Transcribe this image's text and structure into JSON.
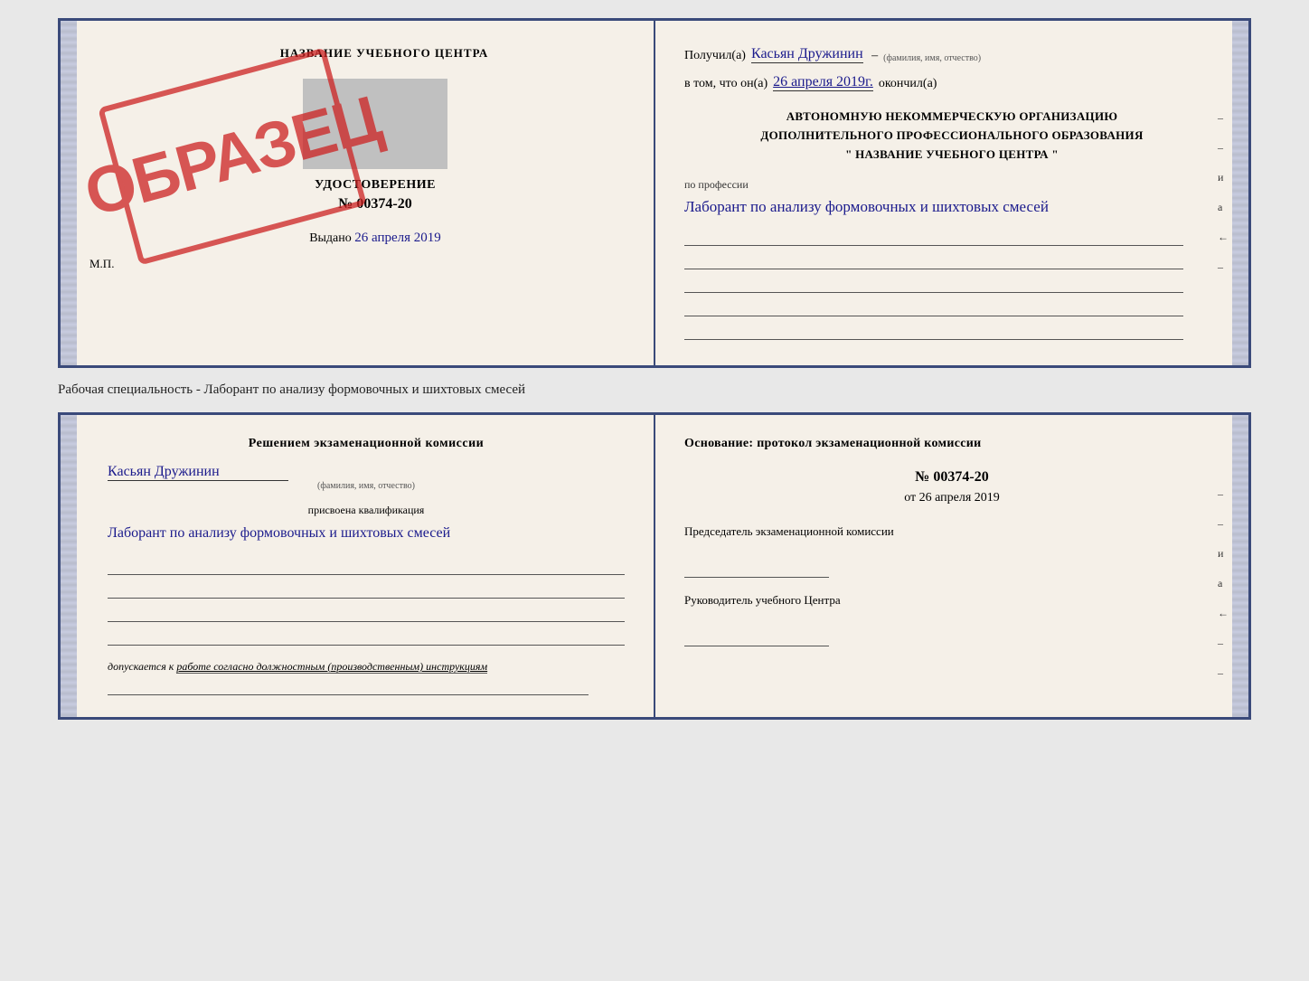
{
  "top_section": {
    "left": {
      "title": "НАЗВАНИЕ УЧЕБНОГО ЦЕНТРА",
      "cert_subtitle": "УДОСТОВЕРЕНИЕ",
      "cert_number": "№ 00374-20",
      "issued_label": "Выдано",
      "issued_date": "26 апреля 2019",
      "mp_label": "М.П."
    },
    "right": {
      "received_label": "Получил(а)",
      "recipient_name": "Касьян Дружинин",
      "fio_small": "(фамилия, имя, отчество)",
      "in_that_label": "в том, что он(а)",
      "date_completed": "26 апреля 2019г.",
      "finished_label": "окончил(а)",
      "org_line1": "АВТОНОМНУЮ НЕКОММЕРЧЕСКУЮ ОРГАНИЗАЦИЮ",
      "org_line2": "ДОПОЛНИТЕЛЬНОГО ПРОФЕССИОНАЛЬНОГО ОБРАЗОВАНИЯ",
      "org_line3": "\" НАЗВАНИЕ УЧЕБНОГО ЦЕНТРА \"",
      "profession_label": "по профессии",
      "profession_text": "Лаборант по анализу формовочных и шихтовых смесей",
      "edge_chars": [
        "–",
        "–",
        "и",
        "а",
        "←",
        "–"
      ]
    }
  },
  "stamp": {
    "text": "ОБРАЗЕЦ"
  },
  "between_label": "Рабочая специальность - Лаборант по анализу формовочных и шихтовых смесей",
  "bottom_section": {
    "left": {
      "title": "Решением экзаменационной комиссии",
      "name": "Касьян Дружинин",
      "fio_small": "(фамилия, имя, отчество)",
      "qualification_label": "присвоена квалификация",
      "qualification_text": "Лаборант по анализу формовочных и шихтовых смесей",
      "allowed_label": "допускается к",
      "allowed_text": "работе согласно должностным (производственным) инструкциям"
    },
    "right": {
      "basis_label": "Основание: протокол экзаменационной комиссии",
      "protocol_number": "№ 00374-20",
      "date_prefix": "от",
      "date": "26 апреля 2019",
      "chairman_label": "Председатель экзаменационной комиссии",
      "director_label": "Руководитель учебного Центра",
      "edge_chars": [
        "–",
        "–",
        "и",
        "а",
        "←",
        "–",
        "–"
      ]
    }
  }
}
